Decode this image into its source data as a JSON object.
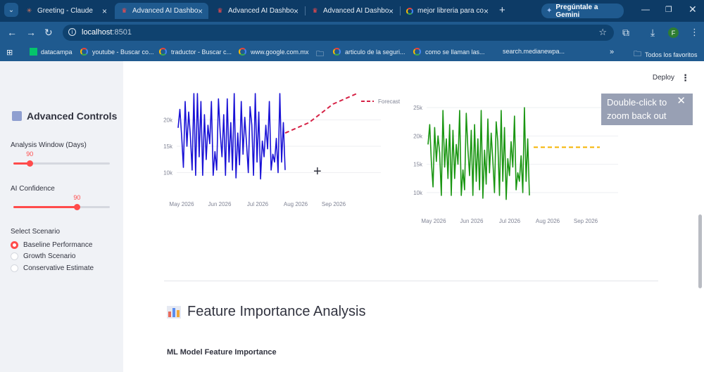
{
  "browser": {
    "tabs": [
      {
        "label": "Greeting - Claude",
        "icon": "claude-icon",
        "active": false
      },
      {
        "label": "Advanced AI Dashbo",
        "icon": "streamlit-icon",
        "active": true
      },
      {
        "label": "Advanced AI Dashbo",
        "icon": "streamlit-icon",
        "active": false
      },
      {
        "label": "Advanced AI Dashbo",
        "icon": "streamlit-icon",
        "active": false
      },
      {
        "label": "mejor libreria para co",
        "icon": "google-icon",
        "active": false
      }
    ],
    "gemini_label": "Pregúntale a Gemini",
    "profile_initial": "F",
    "url_host": "localhost",
    "url_port": ":8501",
    "bookmarks": [
      {
        "label": "datacampa",
        "icon": "datacamp-icon"
      },
      {
        "label": "youtube - Buscar co...",
        "icon": "google-icon"
      },
      {
        "label": "traductor - Buscar c...",
        "icon": "google-icon"
      },
      {
        "label": "www.google.com.mx",
        "icon": "google-icon"
      },
      {
        "label": "",
        "icon": "folder-icon"
      },
      {
        "label": "articulo de la seguri...",
        "icon": "google-icon"
      },
      {
        "label": "como se llaman las...",
        "icon": "google-icon"
      },
      {
        "label": "search.medianewpa...",
        "icon": "none"
      }
    ],
    "all_bookmarks_label": "Todos los favoritos"
  },
  "sidebar": {
    "title": "Advanced Controls",
    "window_label": "Analysis Window (Days)",
    "window_value": "90",
    "window_fraction": 0.17,
    "confidence_label": "AI Confidence",
    "confidence_value": "90",
    "confidence_fraction": 0.66,
    "scenario_label": "Select Scenario",
    "scenarios": [
      {
        "label": "Baseline Performance",
        "selected": true
      },
      {
        "label": "Growth Scenario",
        "selected": false
      },
      {
        "label": "Conservative Estimate",
        "selected": false
      }
    ]
  },
  "header": {
    "deploy_label": "Deploy"
  },
  "tooltip": {
    "line1": "Double-click to",
    "line2": "zoom back out"
  },
  "section": {
    "title": "Feature Importance Analysis",
    "subtitle": "ML Model Feature Importance"
  },
  "chart_data": [
    {
      "type": "line",
      "xlabels": [
        "May 2026",
        "Jun 2026",
        "Jul 2026",
        "Aug 2026",
        "Sep 2026"
      ],
      "ylabels": [
        "10k",
        "15k",
        "20k"
      ],
      "ylim": [
        7000,
        25000
      ],
      "series": [
        {
          "name": "",
          "color": "#1a12d6",
          "values": [
            18500,
            22000,
            17000,
            11000,
            23500,
            15000,
            21500,
            17000,
            10500,
            25500,
            9500,
            25500,
            13000,
            23500,
            9500,
            21000,
            12500,
            19000,
            15500,
            23500,
            9500,
            14000,
            10500,
            24000,
            17500,
            13000,
            21000,
            9500,
            24000,
            12000,
            19500,
            10500,
            25500,
            9000,
            17500,
            11500,
            23500,
            13500,
            20500,
            15500,
            10000,
            22500,
            19000,
            9500,
            25500,
            12000,
            21500,
            8800,
            16000,
            13000,
            19000,
            14500,
            23500,
            10500,
            13500,
            12000,
            16500,
            10000,
            25000,
            12000,
            19500,
            10500
          ]
        },
        {
          "name": "Forecast",
          "color": "#d62246",
          "dash": true,
          "values": [
            17500,
            19500,
            23000,
            25500
          ]
        }
      ]
    },
    {
      "type": "line",
      "xlabels": [
        "May 2026",
        "Jun 2026",
        "Jul 2026",
        "Aug 2026",
        "Sep 2026"
      ],
      "ylabels": [
        "10k",
        "15k",
        "20k",
        "25k"
      ],
      "ylim": [
        8000,
        26000
      ],
      "series": [
        {
          "name": "",
          "color": "#1a9612",
          "values": [
            18500,
            22000,
            15500,
            11000,
            21500,
            15500,
            20000,
            17000,
            9500,
            24500,
            14500,
            19500,
            12500,
            22000,
            9500,
            21000,
            12500,
            18500,
            15000,
            24500,
            9500,
            14000,
            10500,
            24000,
            17500,
            13000,
            21000,
            9500,
            22000,
            12000,
            19500,
            10500,
            24500,
            9000,
            17500,
            11500,
            23000,
            13500,
            20500,
            15500,
            10000,
            22500,
            19000,
            9500,
            24500,
            12000,
            21500,
            8800,
            16000,
            13000,
            19000,
            14500,
            23500,
            10500,
            13500,
            12000,
            16500,
            10000,
            25000,
            12000,
            19500,
            9500
          ]
        },
        {
          "name": "",
          "color": "#f5b400",
          "dash": true,
          "values": [
            18000,
            18000,
            18000,
            18000,
            18000,
            18000
          ]
        }
      ]
    }
  ]
}
